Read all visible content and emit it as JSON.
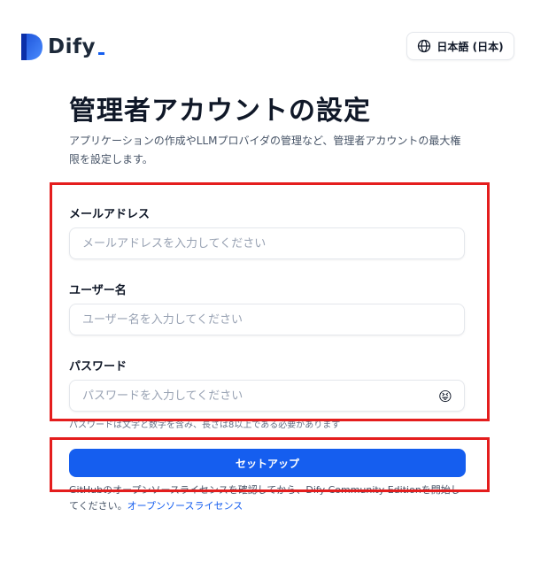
{
  "header": {
    "logo_text": "Dify",
    "language_label": "日本語 (日本)"
  },
  "main": {
    "title": "管理者アカウントの設定",
    "subtitle": "アプリケーションの作成やLLMプロバイダの管理など、管理者アカウントの最大権限を設定します。"
  },
  "form": {
    "email": {
      "label": "メールアドレス",
      "placeholder": "メールアドレスを入力してください",
      "value": ""
    },
    "username": {
      "label": "ユーザー名",
      "placeholder": "ユーザー名を入力してください",
      "value": ""
    },
    "password": {
      "label": "パスワード",
      "placeholder": "パスワードを入力してください",
      "value": "",
      "toggle_icon": "😝",
      "hint": "パスワードは文字と数字を含み、長さは8以上である必要があります"
    },
    "setup_label": "セットアップ"
  },
  "footer": {
    "license_text": "GitHubのオープンソースライセンスを確認してから、Dify Community Editionを開始してください。",
    "license_link": "オープンソースライセンス"
  },
  "colors": {
    "primary": "#155eef",
    "highlight": "#e41d1d"
  }
}
